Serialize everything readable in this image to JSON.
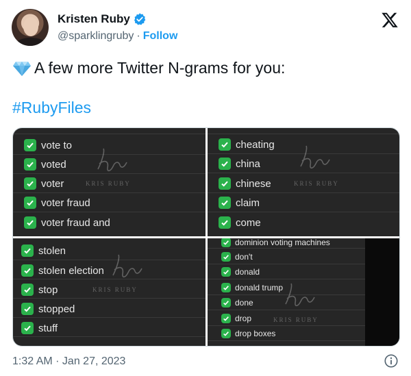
{
  "author": {
    "name": "Kristen Ruby",
    "handle": "@sparklingruby",
    "separator": "·",
    "follow_label": "Follow"
  },
  "tweet": {
    "text": "A few more Twitter N-grams for you:",
    "hashtag": "#RubyFiles",
    "timestamp": "1:32 AM · Jan 27, 2023"
  },
  "media": {
    "watermark": "KRIS RUBY",
    "panel_1": [
      "vote to",
      "voted",
      "voter",
      "voter fraud",
      "voter fraud and"
    ],
    "panel_2": [
      "cheating",
      "china",
      "chinese",
      "claim",
      "come"
    ],
    "panel_3": [
      "stolen",
      "stolen election",
      "stop",
      "stopped",
      "stuff"
    ],
    "panel_4": [
      "dominion voting machines",
      "don't",
      "donald",
      "donald trump",
      "done",
      "drop",
      "drop boxes"
    ]
  },
  "icons": {
    "verified": "verified-badge-icon",
    "x_logo": "x-logo-icon",
    "gem": "gem-emoji-icon",
    "checkbox": "checkbox-checked-icon",
    "info": "info-icon"
  },
  "colors": {
    "link": "#1d9bf0",
    "checkbox": "#2bb24c",
    "panel_bg": "#262626"
  }
}
